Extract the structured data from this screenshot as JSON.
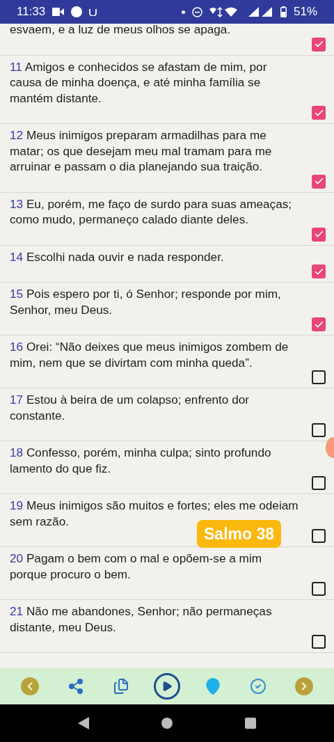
{
  "status_bar": {
    "time": "11:33",
    "battery": "51%"
  },
  "verses": [
    {
      "text": "esvaem, e a luz de meus olhos se apaga.",
      "checked": true
    },
    {
      "number": "11",
      "text": "Amigos e conhecidos se afastam de mim, por causa de minha doença, e até minha família se mantém distante.",
      "checked": true
    },
    {
      "number": "12",
      "text": "Meus inimigos preparam armadilhas para me matar; os que desejam meu mal tramam para me arruinar e passam o dia planejando sua traição.",
      "checked": true
    },
    {
      "number": "13",
      "text": "Eu, porém, me faço de surdo para suas ameaças; como mudo, permaneço calado diante deles.",
      "checked": true
    },
    {
      "number": "14",
      "text": "Escolhi nada ouvir e nada responder.",
      "checked": true
    },
    {
      "number": "15",
      "text": "Pois espero por ti, ó Senhor; responde por mim, Senhor, meu Deus.",
      "checked": true
    },
    {
      "number": "16",
      "text": "Orei: “Não deixes que meus inimigos zombem de mim, nem que se divirtam com minha queda”.",
      "checked": false
    },
    {
      "number": "17",
      "text": "Estou à beira de um colapso; enfrento dor constante.",
      "checked": false
    },
    {
      "number": "18",
      "text": "Confesso, porém, minha culpa; sinto profundo lamento do que fiz.",
      "checked": false
    },
    {
      "number": "19",
      "text": "Meus inimigos são muitos e fortes; eles me odeiam sem razão.",
      "checked": false
    },
    {
      "number": "20",
      "text": "Pagam o bem com o mal e opõem-se a mim porque procuro o bem.",
      "checked": false
    },
    {
      "number": "21",
      "text": "Não me abandones, Senhor; não permaneças distante, meu Deus.",
      "checked": false
    }
  ],
  "badge": "Salmo 38"
}
